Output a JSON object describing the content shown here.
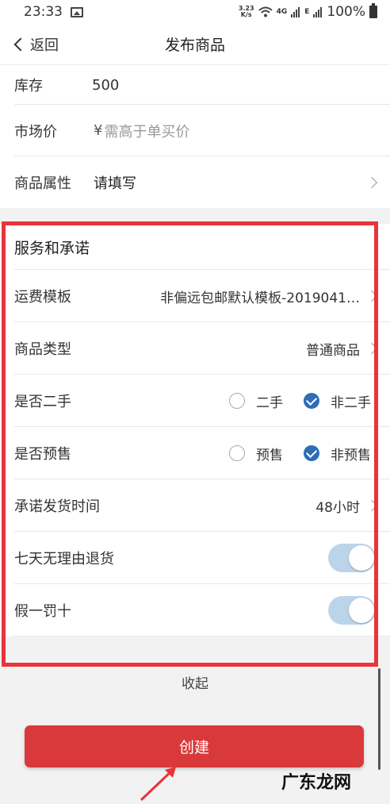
{
  "status_bar": {
    "time": "23:33",
    "speed_value": "3.23",
    "speed_unit": "K/s",
    "net_type_1": "4G",
    "net_type_2": "E",
    "battery": "100%"
  },
  "nav": {
    "back_label": "返回",
    "title": "发布商品"
  },
  "top_fields": [
    {
      "label": "库存",
      "value": "500"
    },
    {
      "label": "市场价",
      "currency": "¥",
      "placeholder": "需高于单买价"
    },
    {
      "label": "商品属性",
      "value": "请填写"
    }
  ],
  "service": {
    "heading": "服务和承诺",
    "shipping_template": {
      "label": "运费模板",
      "value": "非偏远包邮默认模板-2019041…"
    },
    "product_type": {
      "label": "商品类型",
      "value": "普通商品"
    },
    "second_hand": {
      "label": "是否二手",
      "options": [
        "二手",
        "非二手"
      ],
      "selected": "非二手"
    },
    "presale": {
      "label": "是否预售",
      "options": [
        "预售",
        "非预售"
      ],
      "selected": "非预售"
    },
    "ship_time": {
      "label": "承诺发货时间",
      "value": "48小时"
    },
    "seven_day_return": {
      "label": "七天无理由退货",
      "enabled": true
    },
    "fake_penalty": {
      "label": "假一罚十",
      "enabled": true
    }
  },
  "collapse_label": "收起",
  "create_label": "创建",
  "watermark": "广东龙网",
  "colors": {
    "accent": "#2f6db5",
    "create_button": "#d9393a",
    "highlight_border": "#e8343a",
    "toggle_track": "#bcd4ea"
  }
}
